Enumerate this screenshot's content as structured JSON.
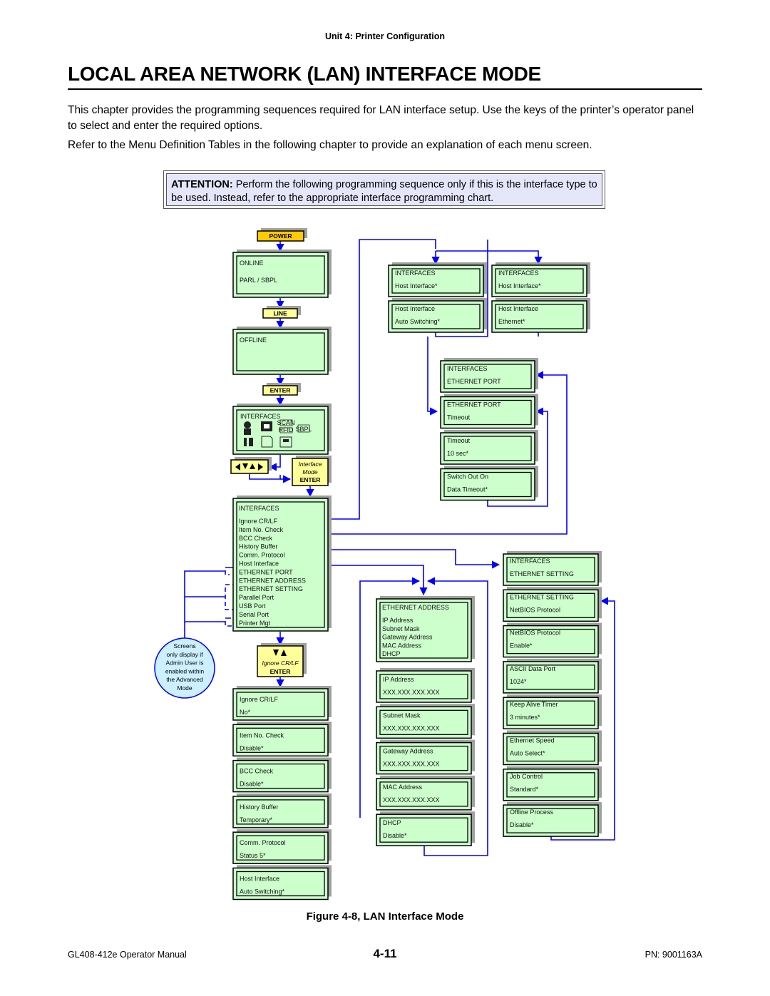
{
  "header": {
    "unit": "Unit 4:  Printer Configuration"
  },
  "page_title": "LOCAL AREA NETWORK (LAN) INTERFACE MODE",
  "paragraphs": [
    "This chapter provides the programming sequences required for LAN interface setup. Use the keys of the printer’s operator panel to select and enter the required options.",
    "Refer to the Menu Definition Tables in the following chapter to provide an explanation of each menu screen."
  ],
  "attention": {
    "label": "ATTENTION:",
    "text": " Perform the following programming sequence only if this is the interface type to be used. Instead, refer to the appropriate interface programming chart."
  },
  "diagram": {
    "colors": {
      "lcd_fill": "#ccffcc",
      "key_fill": "#ffff99",
      "power_fill": "#ffcc00",
      "connector": "#0000ff",
      "shadow": "#a0a0a0",
      "note_fill": "#ccf0ff"
    },
    "keys": {
      "power": "POWER",
      "line": "LINE",
      "enter": "ENTER",
      "interface_mode": [
        "Interface",
        "Mode",
        "ENTER"
      ],
      "ignore_crlf": [
        "Ignore CR/LF",
        "ENTER"
      ],
      "nav_arrows_icon": "left-down-up-right-arrows-icon",
      "updown_arrows_icon": "down-up-arrows-icon"
    },
    "left_column": {
      "online": [
        "ONLINE",
        "PARL / SBPL"
      ],
      "offline": [
        "OFFLINE"
      ],
      "interfaces_icons": {
        "title": "INTERFACES",
        "icons": [
          "user-icon",
          "connector-icon",
          "scan-rfid-icon",
          "sbpl-icon",
          "tools-icon",
          "document-icon",
          "printer-icon"
        ],
        "icon_labels": [
          "SCAN",
          "RFID",
          "SBPL"
        ]
      },
      "interfaces_list": {
        "title": "INTERFACES",
        "items": [
          "Ignore CR/LF",
          "Item No. Check",
          "BCC Check",
          "History Buffer",
          "Comm. Protocol",
          "Host Interface",
          "ETHERNET PORT",
          "ETHERNET ADDRESS",
          "ETHERNET SETTING",
          "Parallel Port",
          "USB Port",
          "Serial Port",
          "Printer Mgt"
        ]
      },
      "settings": [
        [
          "Ignore CR/LF",
          "No*"
        ],
        [
          "Item No. Check",
          "Disable*"
        ],
        [
          "BCC Check",
          "Disable*"
        ],
        [
          "History Buffer",
          "Temporary*"
        ],
        [
          "Comm. Protocol",
          "Status 5*"
        ],
        [
          "Host Interface",
          "Auto Switching*"
        ]
      ]
    },
    "note": [
      "Screens",
      "only display if",
      "Admin User is",
      "enabled within",
      "the Advanced",
      "Mode"
    ],
    "host_interface_column_a": [
      [
        "INTERFACES",
        "Host Interface*"
      ],
      [
        "Host Interface",
        "Auto Switching*"
      ]
    ],
    "host_interface_column_b": [
      [
        "INTERFACES",
        "Host Interface*"
      ],
      [
        "Host Interface",
        "Ethernet*"
      ]
    ],
    "ethernet_port": [
      [
        "INTERFACES",
        "ETHERNET PORT"
      ],
      [
        "ETHERNET PORT",
        "Timeout"
      ],
      [
        "Timeout",
        "10  sec*"
      ],
      [
        "Switch Out On",
        "Data Timeout*"
      ]
    ],
    "ethernet_address": {
      "title": "ETHERNET ADDRESS",
      "items": [
        "IP Address",
        "Subnet Mask",
        "Gateway Address",
        "MAC Address",
        "DHCP"
      ],
      "screens": [
        [
          "IP Address",
          "XXX.XXX.XXX.XXX"
        ],
        [
          "Subnet Mask",
          "XXX.XXX.XXX.XXX"
        ],
        [
          "Gateway Address",
          "XXX.XXX.XXX.XXX"
        ],
        [
          "MAC Address",
          "XXX.XXX.XXX.XXX"
        ],
        [
          "DHCP",
          "Disable*"
        ]
      ]
    },
    "ethernet_setting": [
      [
        "INTERFACES",
        "ETHERNET SETTING"
      ],
      [
        "ETHERNET SETTING",
        "NetBIOS Protocol"
      ],
      [
        "NetBIOS Protocol",
        "Enable*"
      ],
      [
        "ASCII Data Port",
        "1024*"
      ],
      [
        "Keep Alive Timer",
        "3 minutes*"
      ],
      [
        "Ethernet Speed",
        "Auto Select*"
      ],
      [
        "Job Control",
        "Standard*"
      ],
      [
        "Offline Process",
        "Disable*"
      ]
    ]
  },
  "caption": "Figure 4-8, LAN Interface Mode",
  "footer": {
    "left": "GL408-412e Operator Manual",
    "page": "4-11",
    "right": "PN: 9001163A"
  }
}
